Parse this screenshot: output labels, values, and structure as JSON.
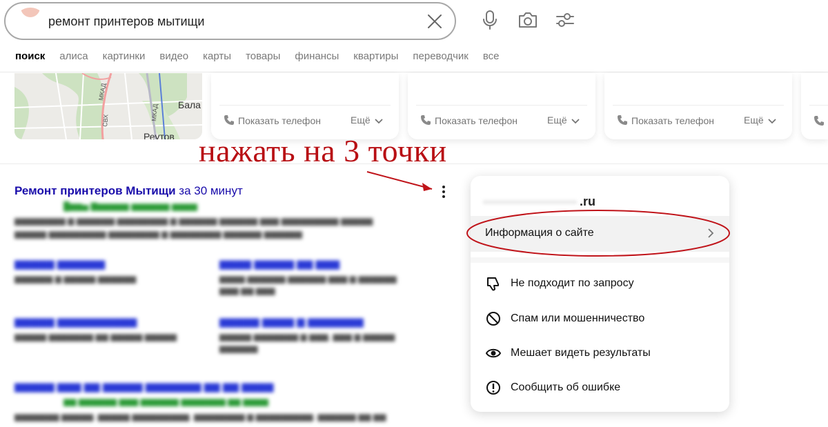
{
  "search": {
    "query": "ремонт принтеров мытищи"
  },
  "icons": {
    "clear": "close-icon",
    "voice": "microphone-icon",
    "camera": "camera-icon",
    "filters": "filter-sliders-icon",
    "phone": "phone-icon",
    "more": "chevron-down-icon",
    "kebab": "vertical-dots-icon",
    "chevron": "chevron-right-icon",
    "dislike": "thumb-down-icon",
    "spam": "block-icon",
    "hide": "eye-icon",
    "report": "exclamation-circle-icon"
  },
  "tabs": [
    {
      "label": "поиск",
      "active": true
    },
    {
      "label": "алиса"
    },
    {
      "label": "картинки"
    },
    {
      "label": "видео"
    },
    {
      "label": "карты"
    },
    {
      "label": "товары"
    },
    {
      "label": "финансы"
    },
    {
      "label": "квартиры"
    },
    {
      "label": "переводчик"
    },
    {
      "label": "все"
    }
  ],
  "map": {
    "road_labels": [
      "МКАД",
      "СВХ",
      "МКАД"
    ],
    "places": [
      "Бала",
      "Реутов"
    ]
  },
  "cards": [
    {
      "phone_label": "Показать телефон",
      "more_label": "Ещё"
    },
    {
      "phone_label": "Показать телефон",
      "more_label": "Ещё"
    },
    {
      "phone_label": "Показать телефон",
      "more_label": "Ещё"
    }
  ],
  "annotation": {
    "text": "нажать на 3 точки"
  },
  "result": {
    "title_bold": "Ремонт принтеров Мытищи",
    "title_rest": " за 30 минут"
  },
  "popup": {
    "domain": ".ru",
    "info_label": "Информация о сайте",
    "menu": [
      {
        "label": "Не подходит по запросу",
        "icon": "thumb-down-icon"
      },
      {
        "label": "Спам или мошенничество",
        "icon": "block-icon"
      },
      {
        "label": "Мешает видеть результаты",
        "icon": "eye-icon"
      },
      {
        "label": "Сообщить об ошибке",
        "icon": "exclamation-circle-icon"
      }
    ]
  },
  "colors": {
    "link": "#1a0dab",
    "annotation": "#b80f14",
    "blurred_url": "#2b9a36"
  }
}
